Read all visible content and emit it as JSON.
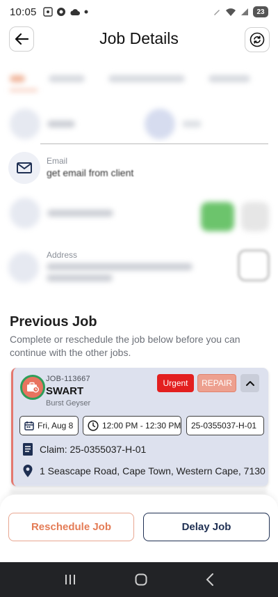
{
  "status_bar": {
    "time": "10:05",
    "battery": "23"
  },
  "header": {
    "title": "Job Details"
  },
  "contact": {
    "email_label": "Email",
    "email_value": "get email from client",
    "address_label": "Address"
  },
  "previous_job": {
    "title": "Previous Job",
    "description": "Complete or reschedule the job below before you can continue with the other jobs.",
    "card": {
      "job_number": "JOB-113667",
      "client": "SWART",
      "job_type": "Burst Geyser",
      "badge_urgent": "Urgent",
      "badge_repair": "REPAIR",
      "date": "Fri, Aug 8",
      "time": "12:00 PM - 12:30 PM",
      "reference": "25-0355037-H-01",
      "claim": "Claim: 25-0355037-H-01",
      "address": "1 Seascape Road, Cape Town, Western Cape, 7130"
    }
  },
  "actions": {
    "reschedule": "Reschedule Job",
    "delay": "Delay Job"
  },
  "colors": {
    "accent_orange": "#e47c56",
    "navy": "#1e2f52",
    "urgent_red": "#e31f1f",
    "repair_salmon": "#eda08f",
    "card_bg": "#dde1ee"
  }
}
